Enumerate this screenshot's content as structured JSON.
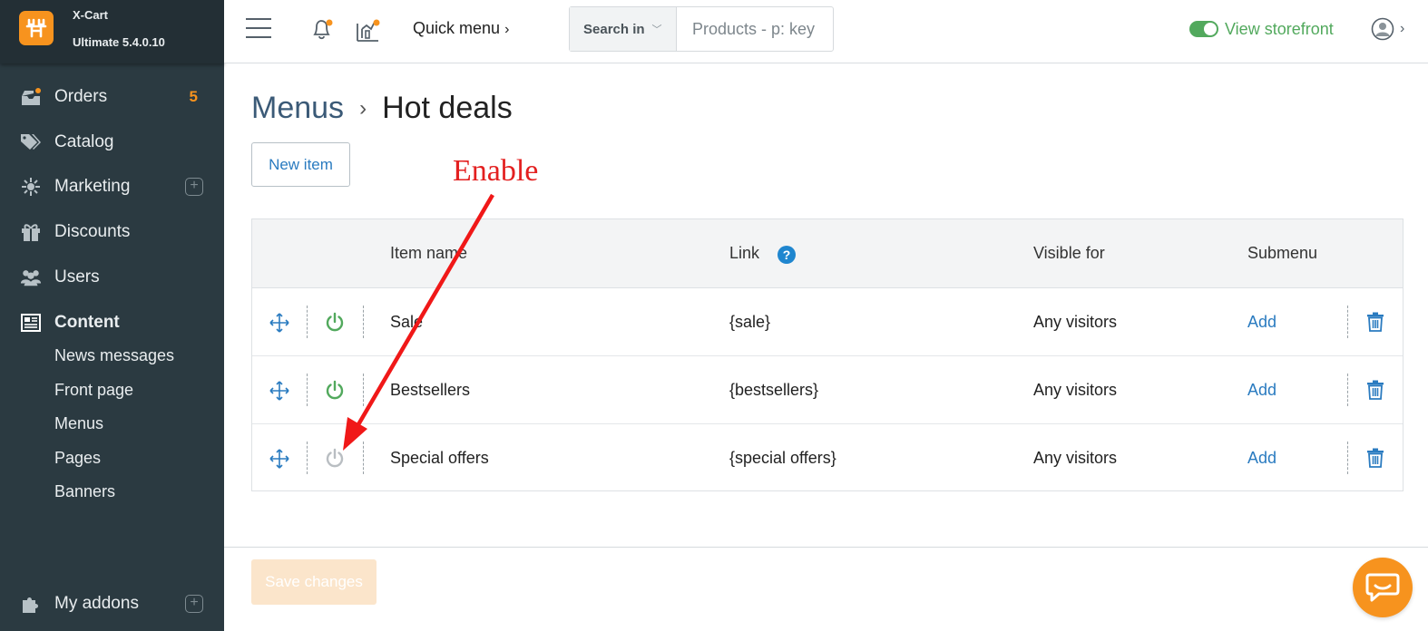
{
  "brand": {
    "name": "X-Cart",
    "version": "Ultimate 5.4.0.10"
  },
  "sidebar": {
    "items": [
      {
        "label": "Orders",
        "icon": "orders-icon",
        "badge": "5"
      },
      {
        "label": "Catalog",
        "icon": "tag-icon"
      },
      {
        "label": "Marketing",
        "icon": "marketing-icon"
      },
      {
        "label": "Discounts",
        "icon": "gift-icon"
      },
      {
        "label": "Users",
        "icon": "users-icon"
      },
      {
        "label": "Content",
        "icon": "newspaper-icon"
      }
    ],
    "content_sub": [
      "News messages",
      "Front page",
      "Menus",
      "Pages",
      "Banners"
    ],
    "addons": {
      "label": "My addons",
      "icon": "puzzle-icon"
    }
  },
  "topbar": {
    "quick_menu": "Quick menu",
    "search_in": "Search in",
    "search_placeholder": "Products - p: key",
    "storefront": "View storefront"
  },
  "breadcrumb": {
    "parent": "Menus",
    "sep": "›",
    "current": "Hot deals"
  },
  "new_item_label": "New item",
  "annotation": "Enable",
  "table": {
    "headers": {
      "name": "Item name",
      "link": "Link",
      "visible": "Visible for",
      "submenu": "Submenu"
    },
    "help_glyph": "?",
    "rows": [
      {
        "name": "Sale",
        "link": "{sale}",
        "visible": "Any visitors",
        "submenu": "Add",
        "enabled": true
      },
      {
        "name": "Bestsellers",
        "link": "{bestsellers}",
        "visible": "Any visitors",
        "submenu": "Add",
        "enabled": true
      },
      {
        "name": "Special offers",
        "link": "{special offers}",
        "visible": "Any visitors",
        "submenu": "Add",
        "enabled": false
      }
    ]
  },
  "save_label": "Save changes",
  "colors": {
    "accent": "#f7931e",
    "sidebar": "#2b3a41",
    "link": "#2a7bc0",
    "enabled": "#52a95d",
    "disabled": "#b9bec2",
    "annotation": "#e32020"
  }
}
